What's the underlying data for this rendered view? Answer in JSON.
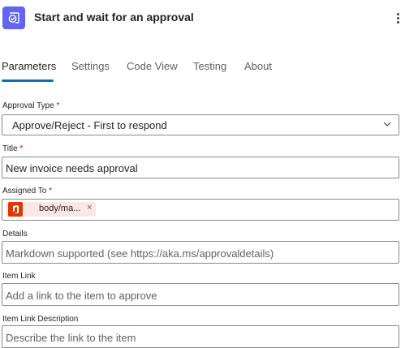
{
  "header": {
    "title": "Start and wait for an approval",
    "icon": "approval-icon",
    "accent": "#6264f5"
  },
  "tabs": [
    {
      "label": "Parameters",
      "active": true
    },
    {
      "label": "Settings",
      "active": false
    },
    {
      "label": "Code View",
      "active": false
    },
    {
      "label": "Testing",
      "active": false
    },
    {
      "label": "About",
      "active": false
    }
  ],
  "fields": {
    "approval_type": {
      "label": "Approval Type",
      "required_mark": "*",
      "value": "Approve/Reject - First to respond"
    },
    "title": {
      "label": "Title",
      "required_mark": "*",
      "value": "New invoice needs approval"
    },
    "assigned_to": {
      "label": "Assigned To",
      "required_mark": "*",
      "token": {
        "text": "body/ma...",
        "icon": "office-icon",
        "remove": "×"
      }
    },
    "details": {
      "label": "Details",
      "placeholder": "Markdown supported (see https://aka.ms/approvaldetails)"
    },
    "item_link": {
      "label": "Item Link",
      "placeholder": "Add a link to the item to approve"
    },
    "item_link_description": {
      "label": "Item Link Description",
      "placeholder": "Describe the link to the item"
    }
  },
  "colors": {
    "tab_underline": "#0f6cbd",
    "required": "#c50f1f",
    "token_bg": "#fbe7e3",
    "office": "#d83b01"
  }
}
